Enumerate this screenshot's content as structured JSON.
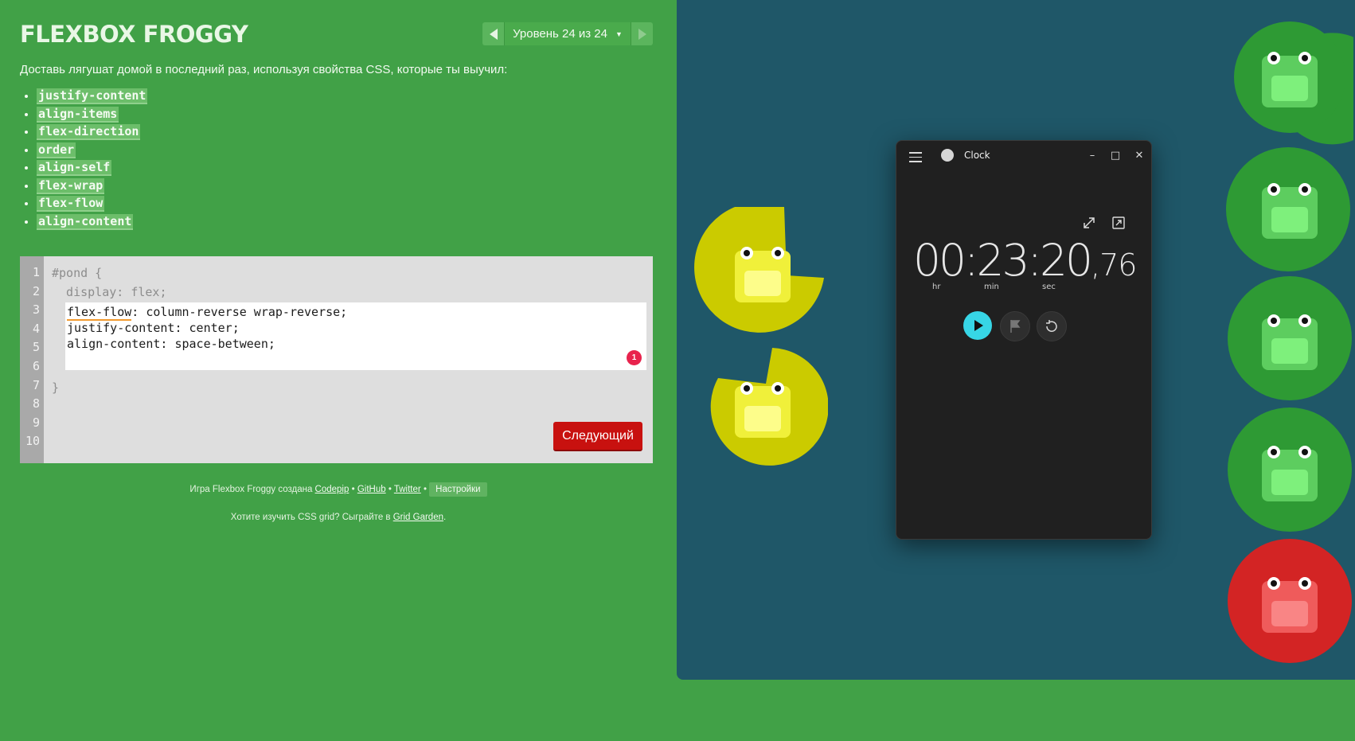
{
  "app": {
    "logo": "FLEXBOX FROGGY",
    "level_label": "Уровень 24 из 24",
    "intro": "Доставь лягушат домой в последний раз, используя свойства CSS, которые ты выучил:"
  },
  "properties": [
    "justify-content",
    "align-items",
    "flex-direction",
    "order",
    "align-self",
    "flex-wrap",
    "flex-flow",
    "align-content"
  ],
  "editor": {
    "line_numbers": [
      "1",
      "2",
      "3",
      "4",
      "5",
      "6",
      "7",
      "8",
      "9",
      "10"
    ],
    "line1": "#pond {",
    "line2": "  display: flex;",
    "input_word": "flex-flow",
    "input_line1_rest": ": column-reverse wrap-reverse;",
    "input_line2": "justify-content: center;",
    "input_line3": "align-content: space-between;",
    "closing": "}",
    "error_count": "1",
    "next_label": "Следующий"
  },
  "footer": {
    "prefix": "Игра Flexbox Froggy создана",
    "link_codepip": "Codepip",
    "sep": "•",
    "link_github": "GitHub",
    "link_twitter": "Twitter",
    "settings": "Настройки",
    "grid_prefix": "Хотите изучить CSS grid? Сыграйте в",
    "grid_link": "Grid Garden",
    "grid_suffix": "."
  },
  "clock": {
    "title": "Clock",
    "time_main": "00:23:20",
    "time_cs": ",76",
    "units": [
      "hr",
      "min",
      "sec"
    ],
    "minimize": "–",
    "maximize": "□",
    "close": "✕",
    "icons": [
      "expand-icon",
      "compact-overlay-icon",
      "play-icon",
      "flag-icon",
      "reset-icon"
    ]
  },
  "colors": {
    "bg": "#41a147",
    "pond": "#1f5768",
    "yellow_pad": "#c9c800",
    "green_pad": "#2f9a35",
    "red_pad": "#d62727",
    "accent": "#3ed8e8"
  }
}
